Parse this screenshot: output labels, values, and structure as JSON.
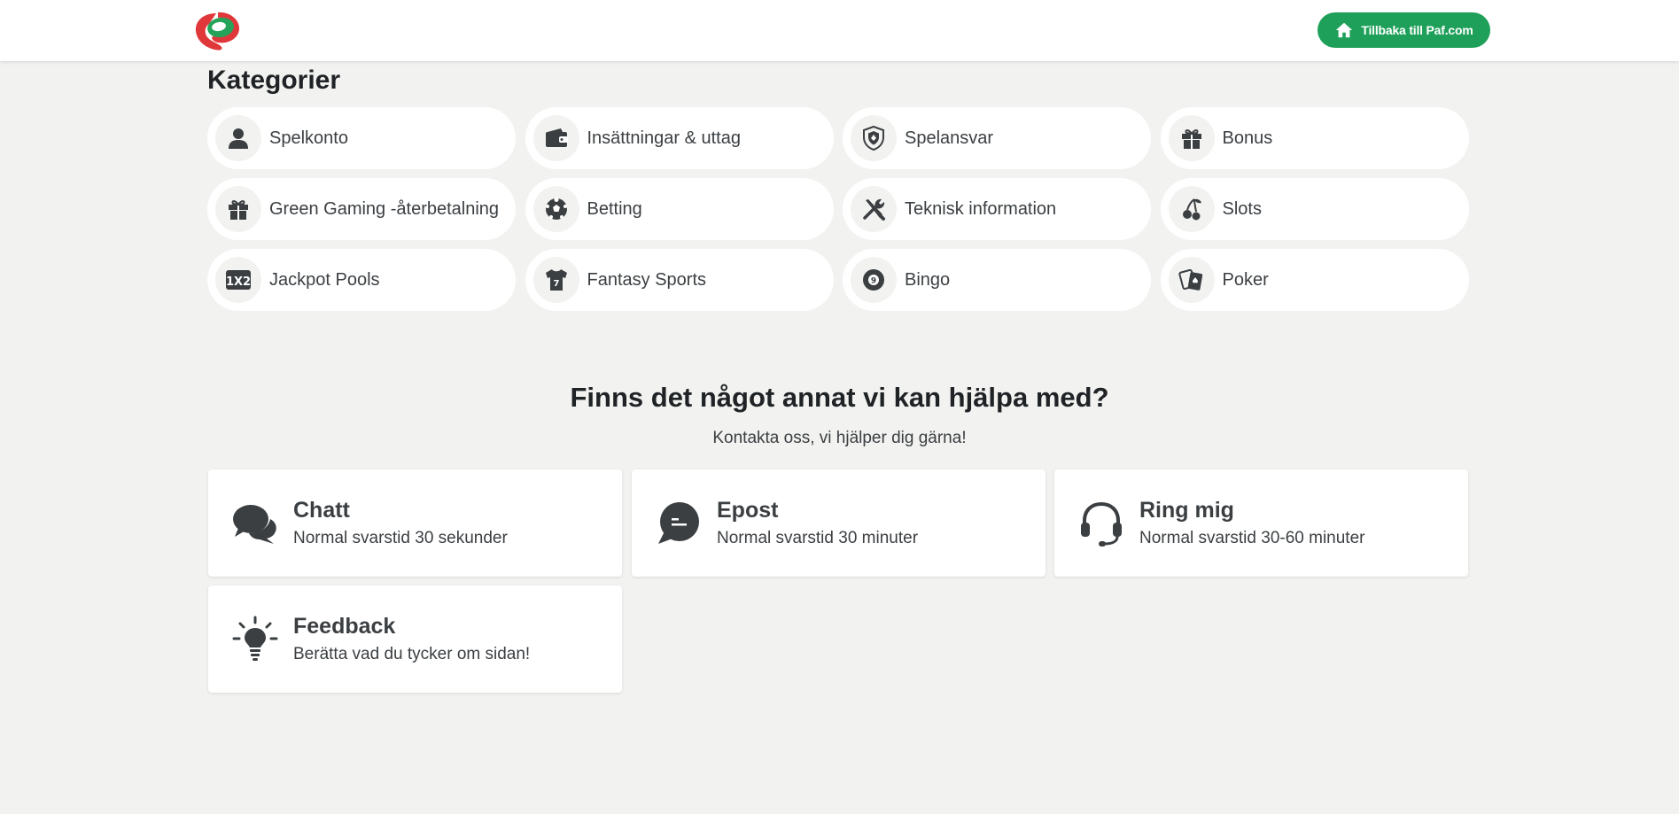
{
  "header": {
    "back_button_label": "Tillbaka till Paf.com",
    "colors": {
      "brand_green": "#1fa05a",
      "logo_red": "#e0383a",
      "logo_green": "#24a359"
    }
  },
  "categories": {
    "title": "Kategorier",
    "items": [
      {
        "label": "Spelkonto",
        "icon": "user-icon"
      },
      {
        "label": "Insättningar & uttag",
        "icon": "wallet-icon"
      },
      {
        "label": "Spelansvar",
        "icon": "shield-icon"
      },
      {
        "label": "Bonus",
        "icon": "gift-icon"
      },
      {
        "label": "Green Gaming -återbetalning",
        "icon": "gift-icon"
      },
      {
        "label": "Betting",
        "icon": "soccer-ball-icon"
      },
      {
        "label": "Teknisk information",
        "icon": "tools-icon"
      },
      {
        "label": "Slots",
        "icon": "cherries-icon"
      },
      {
        "label": "Jackpot Pools",
        "icon": "1x2-icon"
      },
      {
        "label": "Fantasy Sports",
        "icon": "jersey-icon"
      },
      {
        "label": "Bingo",
        "icon": "bingo-ball-icon"
      },
      {
        "label": "Poker",
        "icon": "playing-cards-icon"
      }
    ]
  },
  "help": {
    "title": "Finns det något annat vi kan hjälpa med?",
    "subtitle": "Kontakta oss, vi hjälper dig gärna!",
    "contacts": [
      {
        "title": "Chatt",
        "desc": "Normal svarstid 30 sekunder",
        "icon": "chat-bubbles-icon"
      },
      {
        "title": "Epost",
        "desc": "Normal svarstid 30 minuter",
        "icon": "message-icon"
      },
      {
        "title": "Ring mig",
        "desc": "Normal svarstid 30-60 minuter",
        "icon": "headset-icon"
      },
      {
        "title": "Feedback",
        "desc": "Berätta vad du tycker om sidan!",
        "icon": "lightbulb-icon"
      }
    ]
  }
}
